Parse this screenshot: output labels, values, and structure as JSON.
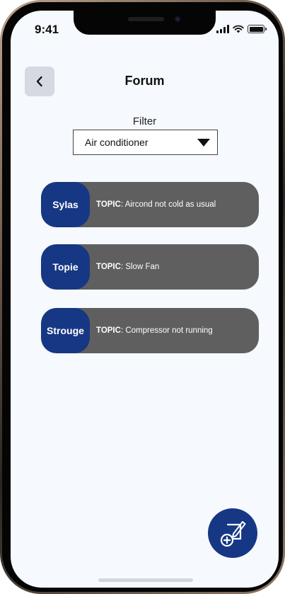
{
  "status_bar": {
    "time": "9:41"
  },
  "header": {
    "title": "Forum"
  },
  "filter": {
    "label": "Filter",
    "selected": "Air conditioner"
  },
  "topics": [
    {
      "user": "Sylas",
      "prefix": "TOPIC",
      "title": "Aircond not cold as usual"
    },
    {
      "user": "Topie",
      "prefix": "TOPIC",
      "title": "Slow Fan"
    },
    {
      "user": "Strouge",
      "prefix": "TOPIC",
      "title": "Compressor not running"
    }
  ],
  "colors": {
    "primary": "#163784",
    "card": "#5f5f5f",
    "background": "#f6f9fd",
    "back_button": "#d6d9e1"
  },
  "icons": {
    "back": "chevron-left-icon",
    "new_post": "compose-plus-icon"
  }
}
